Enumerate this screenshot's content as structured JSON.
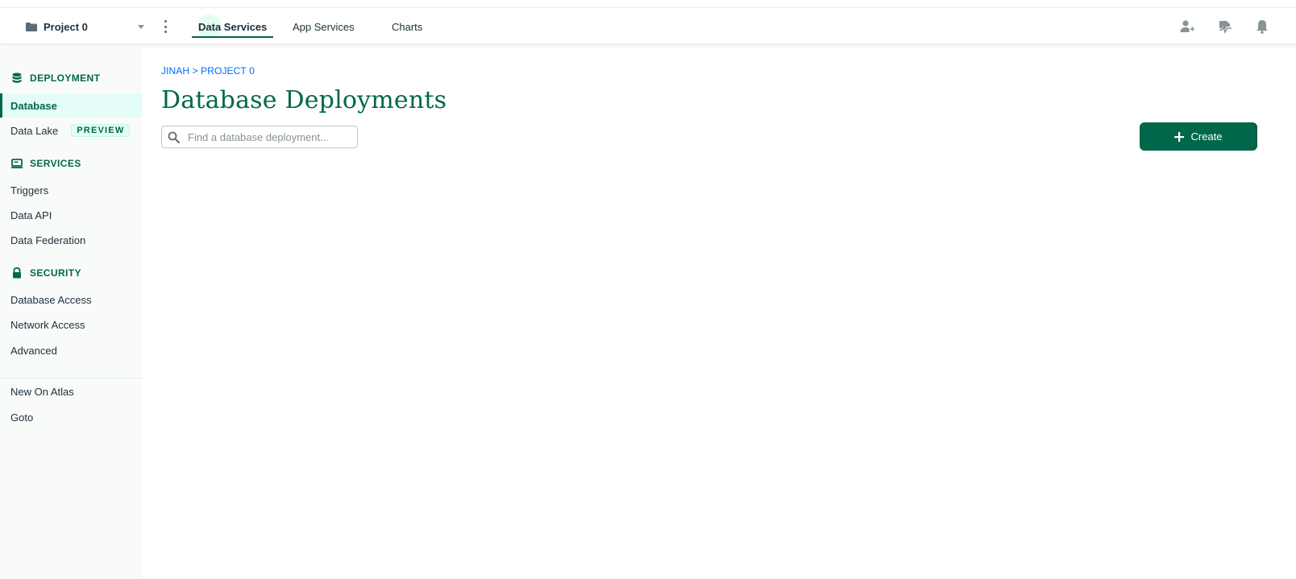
{
  "topbar": {
    "project_name": "Project 0",
    "tabs": [
      {
        "label": "Data Services",
        "active": true
      },
      {
        "label": "App Services",
        "active": false
      },
      {
        "label": "Charts",
        "active": false
      }
    ],
    "icons": [
      "invite-user-icon",
      "activity-icon",
      "bell-icon"
    ]
  },
  "sidebar": {
    "sections": [
      {
        "title": "DEPLOYMENT",
        "icon": "database-icon",
        "items": [
          {
            "label": "Database",
            "active": true
          },
          {
            "label": "Data Lake",
            "badge": "PREVIEW"
          }
        ]
      },
      {
        "title": "SERVICES",
        "icon": "services-icon",
        "items": [
          {
            "label": "Triggers"
          },
          {
            "label": "Data API"
          },
          {
            "label": "Data Federation"
          }
        ]
      },
      {
        "title": "SECURITY",
        "icon": "lock-icon",
        "items": [
          {
            "label": "Database Access"
          },
          {
            "label": "Network Access"
          },
          {
            "label": "Advanced"
          }
        ]
      }
    ],
    "footer_items": [
      {
        "label": "New On Atlas"
      },
      {
        "label": "Goto"
      }
    ]
  },
  "main": {
    "breadcrumb": "JINAH > PROJECT 0",
    "title": "Database Deployments",
    "search_placeholder": "Find a database deployment...",
    "search_value": "",
    "create_label": "Create"
  },
  "colors": {
    "brand_green": "#00684a",
    "link_blue": "#016bf8",
    "active_bg": "#e3fcf7"
  }
}
